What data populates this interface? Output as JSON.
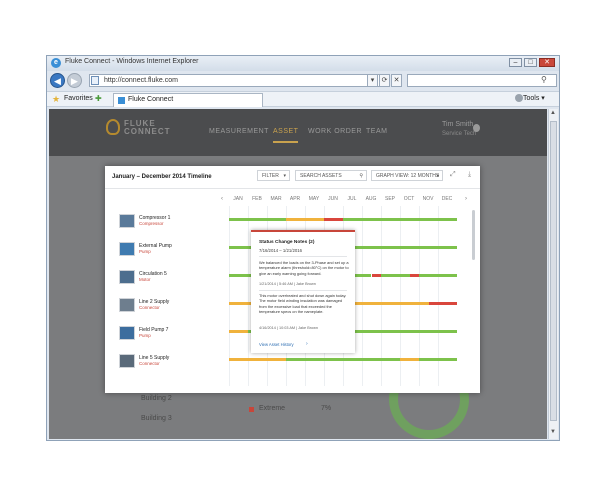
{
  "browser": {
    "window_title": "Fluke Connect - Windows Internet Explorer",
    "address": "http://connect.fluke.com",
    "favorites_label": "Favorites",
    "tab_label": "Fluke Connect",
    "tools_label": "Tools"
  },
  "app": {
    "logo_text": "FLUKE CONNECT",
    "nav": [
      "MEASUREMENT",
      "ASSET",
      "WORK ORDER",
      "TEAM"
    ],
    "active_nav": "ASSET",
    "user_name": "Tim Smith",
    "user_sub": "Service Tech",
    "background_items": [
      "Building 2",
      "Building 3"
    ],
    "legend_label": "Extreme",
    "legend_value": "7%"
  },
  "modal": {
    "title": "January – December 2014 Timeline",
    "filter_label": "FILTER",
    "search_placeholder": "SEARCH ASSETS",
    "graph_view_label": "GRAPH VIEW: 12 MONTHS",
    "months": [
      "JAN",
      "FEB",
      "MAR",
      "APR",
      "MAY",
      "JUN",
      "JUL",
      "AUG",
      "SEP",
      "OCT",
      "NOV",
      "DEC"
    ],
    "assets": [
      {
        "name": "Compressor 1",
        "type": "Compressor",
        "bars": [
          [
            "green",
            0,
            3
          ],
          [
            "yellow",
            3,
            5
          ],
          [
            "red",
            5,
            6
          ],
          [
            "green",
            6,
            12
          ]
        ]
      },
      {
        "name": "External Pump",
        "type": "Pump",
        "bars": [
          [
            "green",
            0,
            12
          ]
        ]
      },
      {
        "name": "Circulation 5",
        "type": "Motor",
        "bars": [
          [
            "green",
            0,
            4
          ],
          [
            "red",
            4,
            4.6
          ],
          [
            "green",
            4.6,
            7.5
          ],
          [
            "red",
            7.5,
            8
          ],
          [
            "green",
            8,
            9.5
          ],
          [
            "red",
            9.5,
            10
          ],
          [
            "green",
            10,
            12
          ]
        ]
      },
      {
        "name": "Line 2 Supply",
        "type": "Connector",
        "bars": [
          [
            "yellow",
            0,
            4
          ],
          [
            "green",
            4,
            6
          ],
          [
            "yellow",
            6,
            10.5
          ],
          [
            "red",
            10.5,
            12
          ]
        ]
      },
      {
        "name": "Field Pump 7",
        "type": "Pump",
        "bars": [
          [
            "yellow",
            0,
            1
          ],
          [
            "green",
            1,
            12
          ]
        ]
      },
      {
        "name": "Line 5 Supply",
        "type": "Connector",
        "bars": [
          [
            "yellow",
            0,
            3
          ],
          [
            "green",
            3,
            9
          ],
          [
            "yellow",
            9,
            10
          ],
          [
            "green",
            10,
            12
          ]
        ]
      }
    ]
  },
  "popup": {
    "title": "Status Change Notes (2)",
    "dates": "7/16/2014 – 1/21/2016",
    "note1": "We balanced the loads on the 3-Phase and set up a temperature alarm (threshold=80°C) on the motor to give an early warning going forward.",
    "meta1": "1/21/2014  |  5:46 AM  |  Jake Brown",
    "note2": "This motor overheated and shut down again today. The motor field winding insulation was damaged from the excessive load that exceeded the temperature specs on the nameplate.",
    "meta2": "4/16/2014  |  10:03 AM  |  Jake Brown",
    "link": "View Asset History"
  },
  "colors": {
    "green": "#7dc24b",
    "yellow": "#f0b23c",
    "red": "#d9463c",
    "accent": "#c9a24e"
  },
  "icons": [
    "ie-logo-icon",
    "back-icon",
    "forward-icon",
    "refresh-icon",
    "stop-icon",
    "search-icon",
    "star-icon",
    "expand-icon",
    "download-icon",
    "user-icon"
  ]
}
